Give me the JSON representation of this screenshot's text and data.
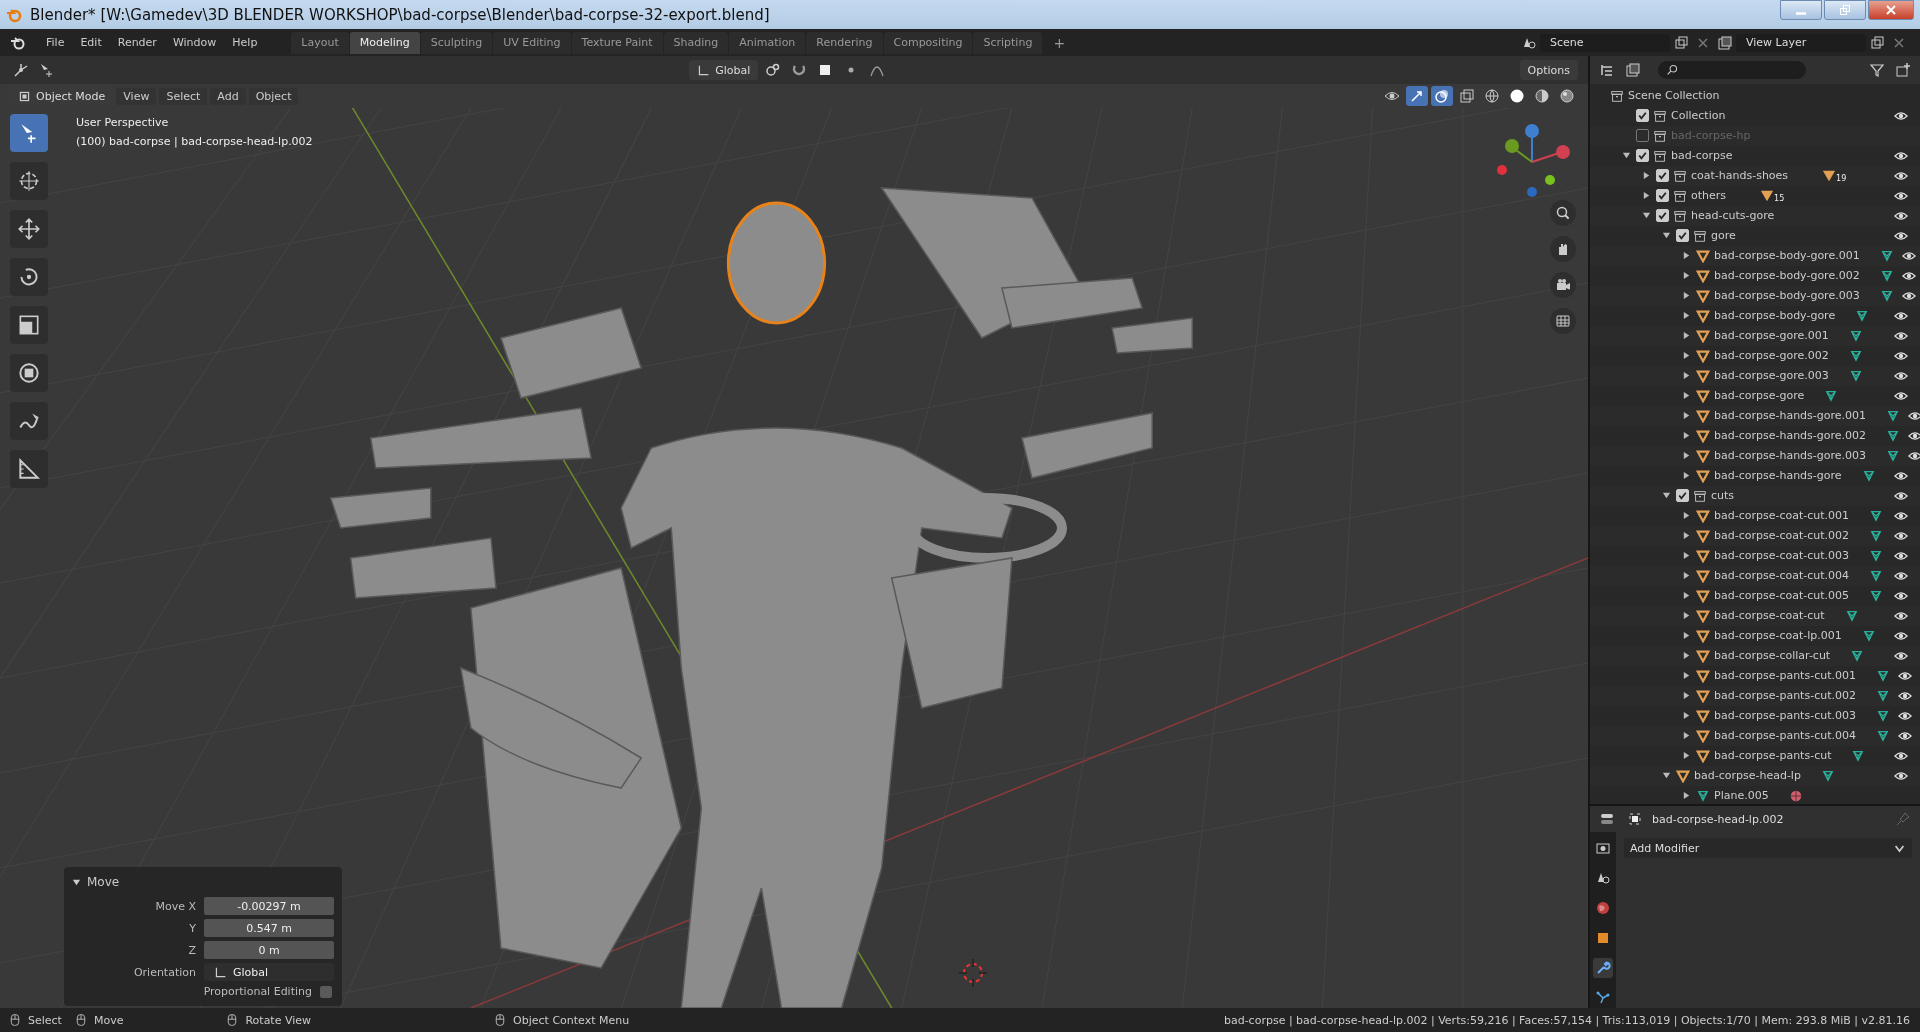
{
  "window": {
    "title": "Blender* [W:\\Gamedev\\3D BLENDER WORKSHOP\\bad-corpse\\Blender\\bad-corpse-32-export.blend]"
  },
  "menu": [
    "File",
    "Edit",
    "Render",
    "Window",
    "Help"
  ],
  "workspaces": [
    {
      "label": "Layout",
      "selected": false
    },
    {
      "label": "Modeling",
      "selected": true
    },
    {
      "label": "Sculpting",
      "selected": false
    },
    {
      "label": "UV Editing",
      "selected": false
    },
    {
      "label": "Texture Paint",
      "selected": false
    },
    {
      "label": "Shading",
      "selected": false
    },
    {
      "label": "Animation",
      "selected": false
    },
    {
      "label": "Rendering",
      "selected": false
    },
    {
      "label": "Compositing",
      "selected": false
    },
    {
      "label": "Scripting",
      "selected": false
    }
  ],
  "add_workspace": "+",
  "scene": "Scene",
  "view_layer": "View Layer",
  "viewport": {
    "orientation": "Global",
    "options": "Options",
    "mode": "Object Mode",
    "menu": [
      "View",
      "Select",
      "Add",
      "Object"
    ],
    "view_name": "User Perspective",
    "object_info": "(100) bad-corpse | bad-corpse-head-lp.002"
  },
  "operator_panel": {
    "title": "Move",
    "expanded": true,
    "fields": [
      {
        "label": "Move X",
        "value": "-0.00297 m"
      },
      {
        "label": "Y",
        "value": "0.547 m"
      },
      {
        "label": "Z",
        "value": "0 m"
      }
    ],
    "orientation_label": "Orientation",
    "orientation": "Global",
    "proportional_label": "Proportional Editing",
    "proportional": false
  },
  "outliner": {
    "root": "Scene Collection",
    "items": [
      {
        "kind": "collection",
        "label": "Collection",
        "checked": true,
        "visible": true
      },
      {
        "kind": "collection",
        "label": "bad-corpse-hp",
        "checked": false,
        "visible": false
      },
      {
        "kind": "collection",
        "label": "bad-corpse",
        "checked": true,
        "visible": true,
        "expanded": true,
        "children": [
          {
            "kind": "collection",
            "label": "coat-hands-shoes",
            "checked": true,
            "visible": true,
            "expanded": false,
            "badge": "19"
          },
          {
            "kind": "collection",
            "label": "others",
            "checked": true,
            "visible": true,
            "expanded": false,
            "badge": "15"
          },
          {
            "kind": "collection",
            "label": "head-cuts-gore",
            "checked": true,
            "visible": true,
            "expanded": true,
            "children": [
              {
                "kind": "collection",
                "label": "gore",
                "checked": true,
                "visible": true,
                "expanded": true,
                "children": [
                  {
                    "kind": "object",
                    "label": "bad-corpse-body-gore.001",
                    "visible": true,
                    "expanded": false
                  },
                  {
                    "kind": "object",
                    "label": "bad-corpse-body-gore.002",
                    "visible": true,
                    "expanded": false
                  },
                  {
                    "kind": "object",
                    "label": "bad-corpse-body-gore.003",
                    "visible": true,
                    "expanded": false
                  },
                  {
                    "kind": "object",
                    "label": "bad-corpse-body-gore",
                    "visible": true,
                    "expanded": false
                  },
                  {
                    "kind": "object",
                    "label": "bad-corpse-gore.001",
                    "visible": true,
                    "expanded": false
                  },
                  {
                    "kind": "object",
                    "label": "bad-corpse-gore.002",
                    "visible": true,
                    "expanded": false
                  },
                  {
                    "kind": "object",
                    "label": "bad-corpse-gore.003",
                    "visible": true,
                    "expanded": false
                  },
                  {
                    "kind": "object",
                    "label": "bad-corpse-gore",
                    "visible": true,
                    "expanded": false
                  },
                  {
                    "kind": "object",
                    "label": "bad-corpse-hands-gore.001",
                    "visible": true,
                    "expanded": false
                  },
                  {
                    "kind": "object",
                    "label": "bad-corpse-hands-gore.002",
                    "visible": true,
                    "expanded": false
                  },
                  {
                    "kind": "object",
                    "label": "bad-corpse-hands-gore.003",
                    "visible": true,
                    "expanded": false
                  },
                  {
                    "kind": "object",
                    "label": "bad-corpse-hands-gore",
                    "visible": true,
                    "expanded": false
                  }
                ]
              },
              {
                "kind": "collection",
                "label": "cuts",
                "checked": true,
                "visible": true,
                "expanded": true,
                "children": [
                  {
                    "kind": "object",
                    "label": "bad-corpse-coat-cut.001",
                    "visible": true,
                    "expanded": false
                  },
                  {
                    "kind": "object",
                    "label": "bad-corpse-coat-cut.002",
                    "visible": true,
                    "expanded": false
                  },
                  {
                    "kind": "object",
                    "label": "bad-corpse-coat-cut.003",
                    "visible": true,
                    "expanded": false
                  },
                  {
                    "kind": "object",
                    "label": "bad-corpse-coat-cut.004",
                    "visible": true,
                    "expanded": false
                  },
                  {
                    "kind": "object",
                    "label": "bad-corpse-coat-cut.005",
                    "visible": true,
                    "expanded": false
                  },
                  {
                    "kind": "object",
                    "label": "bad-corpse-coat-cut",
                    "visible": true,
                    "expanded": false
                  },
                  {
                    "kind": "object",
                    "label": "bad-corpse-coat-lp.001",
                    "visible": true,
                    "expanded": false
                  },
                  {
                    "kind": "object",
                    "label": "bad-corpse-collar-cut",
                    "visible": true,
                    "expanded": false
                  },
                  {
                    "kind": "object",
                    "label": "bad-corpse-pants-cut.001",
                    "visible": true,
                    "expanded": false
                  },
                  {
                    "kind": "object",
                    "label": "bad-corpse-pants-cut.002",
                    "visible": true,
                    "expanded": false
                  },
                  {
                    "kind": "object",
                    "label": "bad-corpse-pants-cut.003",
                    "visible": true,
                    "expanded": false
                  },
                  {
                    "kind": "object",
                    "label": "bad-corpse-pants-cut.004",
                    "visible": true,
                    "expanded": false
                  },
                  {
                    "kind": "object",
                    "label": "bad-corpse-pants-cut",
                    "visible": true,
                    "expanded": false
                  }
                ]
              },
              {
                "kind": "object",
                "label": "bad-corpse-head-lp",
                "visible": true,
                "expanded": true,
                "children": [
                  {
                    "kind": "mesh",
                    "label": "Plane.005",
                    "expanded": false,
                    "material": true
                  }
                ]
              }
            ]
          }
        ]
      }
    ]
  },
  "properties": {
    "object": "bad-corpse-head-lp.002",
    "add_modifier": "Add Modifier"
  },
  "status_bar": {
    "hints": [
      "Select",
      "Move",
      "Rotate View",
      "Object Context Menu"
    ],
    "stats": "bad-corpse | bad-corpse-head-lp.002 | Verts:59,216 | Faces:57,154 | Tris:113,019 | Objects:1/70 | Mem: 293.8 MiB | v2.81.16"
  }
}
